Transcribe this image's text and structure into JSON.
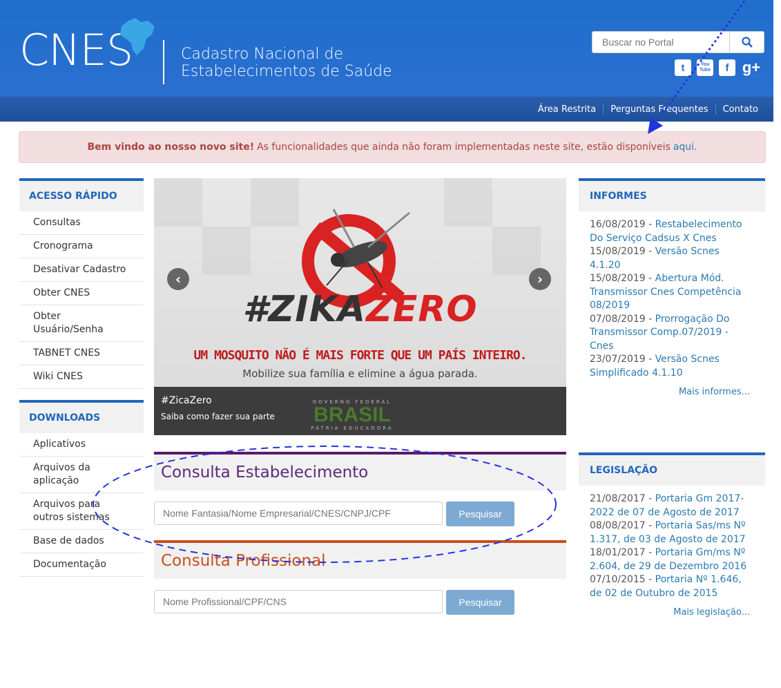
{
  "header": {
    "logo": "CNES",
    "tagline_line1": "Cadastro Nacional de",
    "tagline_line2": "Estabelecimentos de Saúde",
    "search_placeholder": "Buscar no Portal",
    "social": {
      "twitter": "t",
      "youtube": "You Tube",
      "facebook": "f",
      "gplus": "g+"
    }
  },
  "topnav": {
    "items": [
      "Área Restrita",
      "Perguntas Frequentes",
      "Contato"
    ]
  },
  "alert": {
    "bold": "Bem vindo ao nosso novo site!",
    "text": "As funcionalidades que ainda não foram implementadas neste site, estão disponíveis",
    "link": "aqui."
  },
  "sidebar": {
    "acesso_title": "ACESSO RÁPIDO",
    "acesso_items": [
      "Consultas",
      "Cronograma",
      "Desativar Cadastro",
      "Obter CNES",
      "Obter Usuário/Senha",
      "TABNET CNES",
      "Wiki CNES"
    ],
    "downloads_title": "DOWNLOADS",
    "downloads_items": [
      "Aplicativos",
      "Arquivos da aplicação",
      "Arquivos para outros sistemas",
      "Base de dados",
      "Documentação"
    ]
  },
  "banner": {
    "hashtag_left": "#ZIKA",
    "hashtag_right": "ZERO",
    "headline": "UM MOSQUITO NÃO É MAIS FORTE QUE UM PAÍS INTEIRO.",
    "subline": "Mobilize sua família e elimine a água parada.",
    "caption_title": "#ZicaZero",
    "caption_sub": "Saiba como fazer sua parte",
    "gov_top": "GOVERNO FEDERAL",
    "gov_brand": "BRASIL",
    "gov_bottom": "PÁTRIA EDUCADORA",
    "prev": "‹",
    "next": "›"
  },
  "consulta_estab": {
    "title": "Consulta Estabelecimento",
    "placeholder": "Nome Fantasia/Nome Empresarial/CNES/CNPJ/CPF",
    "button": "Pesquisar"
  },
  "consulta_prof": {
    "title": "Consulta Profissional",
    "placeholder": "Nome Profissional/CPF/CNS",
    "button": "Pesquisar"
  },
  "informes": {
    "title": "INFORMES",
    "items": [
      {
        "date": "16/08/2019 -",
        "text": "Restabelecimento Do Serviço Cadsus X Cnes"
      },
      {
        "date": "15/08/2019 -",
        "text": "Versão Scnes 4.1.20"
      },
      {
        "date": "15/08/2019 -",
        "text": "Abertura Mód. Transmissor Cnes Competência 08/2019"
      },
      {
        "date": "07/08/2019 -",
        "text": "Prorrogação Do Transmissor Comp.07/2019 - Cnes"
      },
      {
        "date": "23/07/2019 -",
        "text": "Versão Scnes Simplificado 4.1.10"
      }
    ],
    "more": "Mais informes..."
  },
  "legislacao": {
    "title": "LEGISLAÇÃO",
    "items": [
      {
        "date": "21/08/2017 -",
        "text": "Portaria Gm 2017-2022 de 07 de Agosto de 2017"
      },
      {
        "date": "08/08/2017 -",
        "text": "Portaria Sas/ms Nº 1.317, de 03 de Agosto de 2017"
      },
      {
        "date": "18/01/2017 -",
        "text": "Portaria Gm/ms Nº 2.604, de 29 de Dezembro 2016"
      },
      {
        "date": "07/10/2015 -",
        "text": "Portaria Nº 1.646, de 02 de Outubro de 2015"
      }
    ],
    "more": "Mais legislação..."
  },
  "colors": {
    "header_blue": "#2a6fd0",
    "nav_blue": "#1e4f99",
    "accent_blue": "#2266bb",
    "purple": "#5a1a6a",
    "orange": "#c84f1c",
    "alert_bg": "#f2dede",
    "annotation": "#2233dd"
  }
}
